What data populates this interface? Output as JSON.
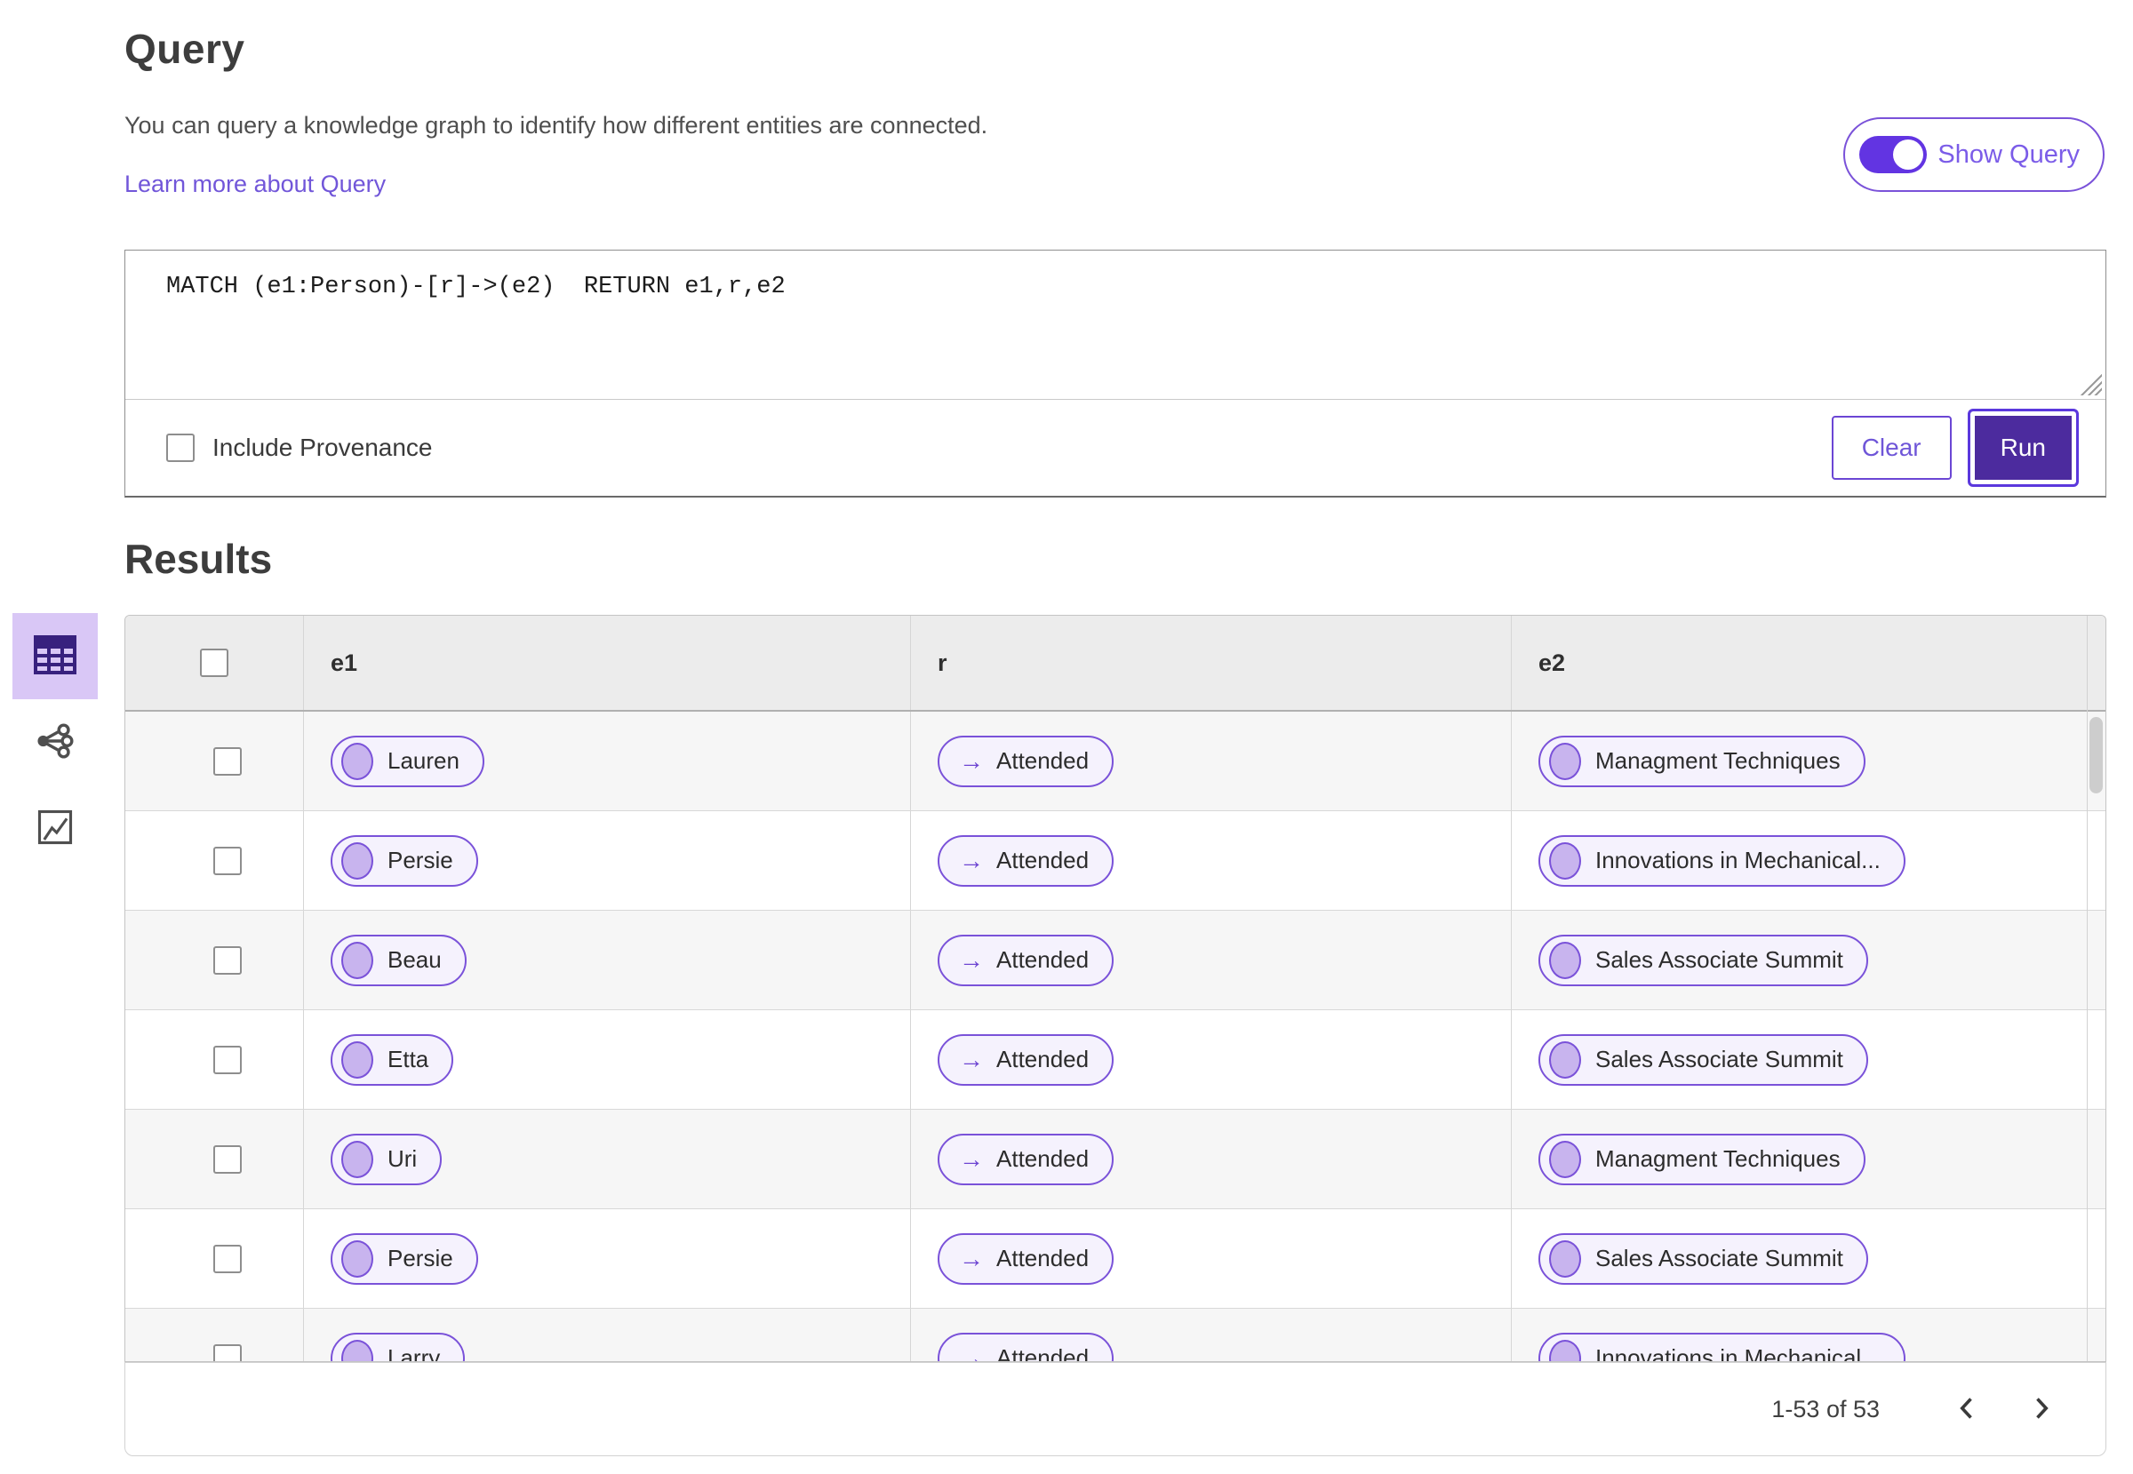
{
  "query_section": {
    "title": "Query",
    "description": "You can query a knowledge graph to identify how different entities are connected.",
    "link_label": "Learn more about Query",
    "show_query_label": "Show Query",
    "show_query_state": "on",
    "query_text": "MATCH (e1:Person)-[r]->(e2)  RETURN e1,r,e2",
    "include_provenance_label": "Include Provenance",
    "include_provenance_checked": false,
    "clear_label": "Clear",
    "run_label": "Run"
  },
  "results_section": {
    "title": "Results",
    "views": [
      {
        "name": "table-view",
        "selected": true
      },
      {
        "name": "graph-view",
        "selected": false
      },
      {
        "name": "chart-view",
        "selected": false
      }
    ],
    "relation_arrow": "→",
    "table": {
      "columns": [
        "e1",
        "r",
        "e2"
      ],
      "rows": [
        {
          "e1": "Lauren",
          "r": "Attended",
          "e2": "Managment Techniques"
        },
        {
          "e1": "Persie",
          "r": "Attended",
          "e2": "Innovations in Mechanical..."
        },
        {
          "e1": "Beau",
          "r": "Attended",
          "e2": "Sales Associate Summit"
        },
        {
          "e1": "Etta",
          "r": "Attended",
          "e2": "Sales Associate Summit"
        },
        {
          "e1": "Uri",
          "r": "Attended",
          "e2": "Managment Techniques"
        },
        {
          "e1": "Persie",
          "r": "Attended",
          "e2": "Sales Associate Summit"
        },
        {
          "e1": "Larry",
          "r": "Attended",
          "e2": "Innovations in Mechanical..."
        }
      ]
    },
    "pagination": {
      "range_label": "1-53 of 53"
    }
  },
  "colors": {
    "accent_purple": "#6b46d4",
    "run_button_fill": "#4c2b9e",
    "run_button_ring": "#5b38dd",
    "pill_border": "#7a52d9",
    "pill_background": "#f5f2fd",
    "pill_dot": "#c8b4ee",
    "link": "#7156d9",
    "selected_view_tile": "#d9c7f6",
    "table_header_bg": "#ececec",
    "row_alt_bg": "#f6f6f6"
  }
}
